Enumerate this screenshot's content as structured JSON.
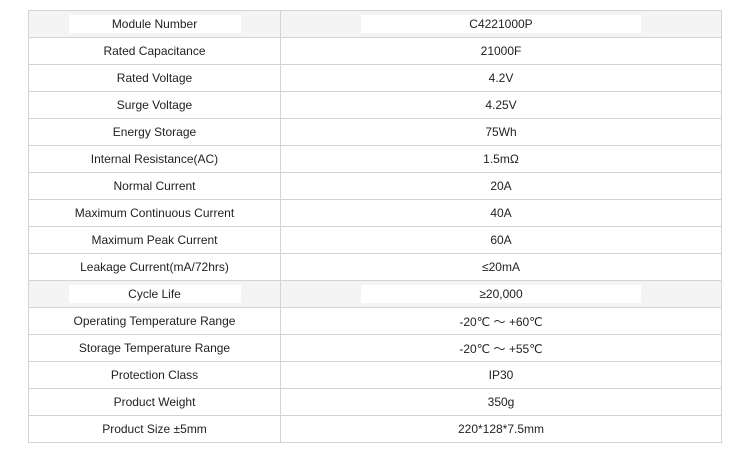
{
  "spec_table": {
    "rows": [
      {
        "label": "Module Number",
        "value": "C4221000P",
        "shaded": true
      },
      {
        "label": "Rated Capacitance",
        "value": "21000F",
        "shaded": false
      },
      {
        "label": "Rated Voltage",
        "value": "4.2V",
        "shaded": false
      },
      {
        "label": "Surge Voltage",
        "value": "4.25V",
        "shaded": false
      },
      {
        "label": "Energy Storage",
        "value": "75Wh",
        "shaded": false
      },
      {
        "label": "Internal Resistance(AC)",
        "value": "1.5mΩ",
        "shaded": false
      },
      {
        "label": "Normal Current",
        "value": "20A",
        "shaded": false
      },
      {
        "label": "Maximum Continuous Current",
        "value": "40A",
        "shaded": false
      },
      {
        "label": "Maximum Peak Current",
        "value": "60A",
        "shaded": false
      },
      {
        "label": "Leakage Current(mA/72hrs)",
        "value": "≤20mA",
        "shaded": false
      },
      {
        "label": "Cycle Life",
        "value": "≥20,000",
        "shaded": true
      },
      {
        "label": "Operating Temperature Range",
        "value": "-20℃ ～ +60℃",
        "shaded": false
      },
      {
        "label": "Storage Temperature Range",
        "value": "-20℃ ～ +55℃",
        "shaded": false
      },
      {
        "label": "Protection Class",
        "value": "IP30",
        "shaded": false
      },
      {
        "label": "Product Weight",
        "value": "350g",
        "shaded": false
      },
      {
        "label": "Product Size ±5mm",
        "value": "220*128*7.5mm",
        "shaded": false
      }
    ]
  }
}
